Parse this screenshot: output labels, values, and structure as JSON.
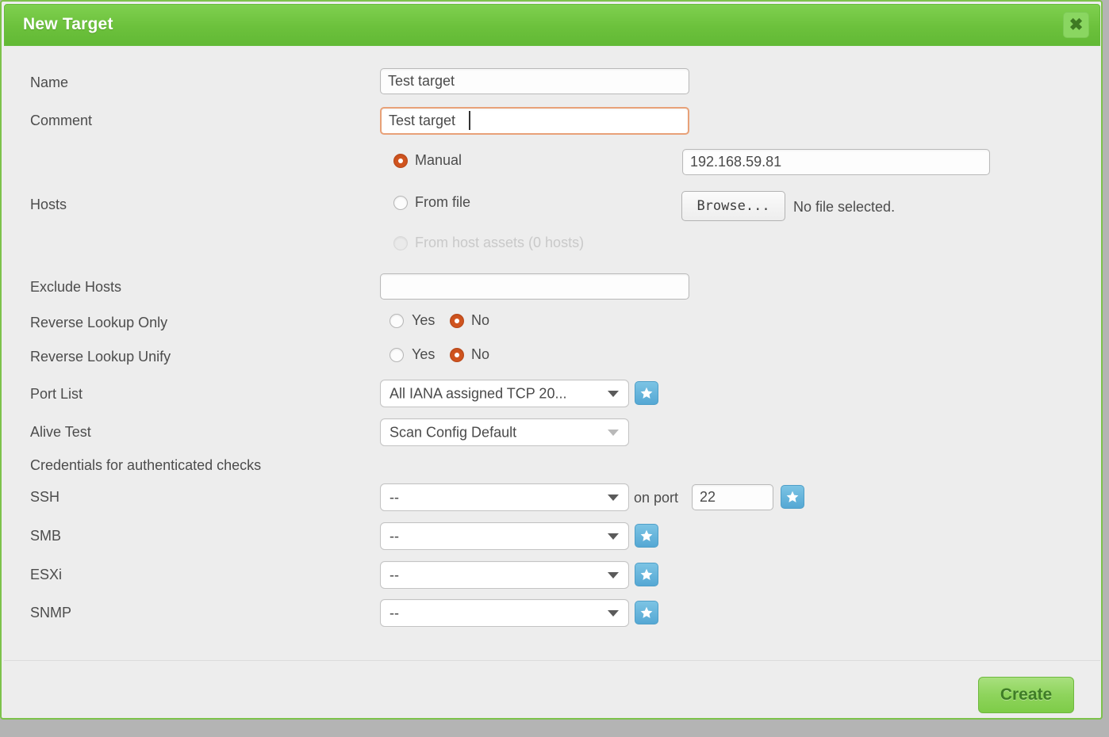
{
  "dialog": {
    "title": "New Target",
    "close_icon": "close-icon",
    "accent_green": "#6cc13c",
    "background": "#ededed",
    "focus_orange": "#e8a178",
    "radio_selected": "#d0541f",
    "star_blue": "#55a8d4"
  },
  "fields": {
    "name": {
      "label": "Name",
      "value": "Test target",
      "placeholder": ""
    },
    "comment": {
      "label": "Comment",
      "value": "Test target ",
      "placeholder": "",
      "focused": true
    },
    "hosts": {
      "label": "Hosts",
      "options": [
        {
          "label": "Manual",
          "selected": true,
          "disabled": false
        },
        {
          "label": "From file",
          "selected": false,
          "disabled": false
        },
        {
          "label": "From host assets (0 hosts)",
          "selected": false,
          "disabled": true
        }
      ],
      "manual_value": "192.168.59.81",
      "browse_label": "Browse...",
      "file_status": "No file selected."
    },
    "exclude_hosts": {
      "label": "Exclude Hosts",
      "value": "",
      "placeholder": ""
    },
    "reverse_lookup_only": {
      "label": "Reverse Lookup Only",
      "yes_label": "Yes",
      "no_label": "No",
      "selected": "No"
    },
    "reverse_lookup_unify": {
      "label": "Reverse Lookup Unify",
      "yes_label": "Yes",
      "no_label": "No",
      "selected": "No"
    },
    "port_list": {
      "label": "Port List",
      "value": "All IANA assigned TCP 20...",
      "star_icon": "star-icon"
    },
    "alive_test": {
      "label": "Alive Test",
      "value": "Scan Config Default"
    },
    "credentials_heading": "Credentials for authenticated checks",
    "ssh": {
      "label": "SSH",
      "value": "--",
      "on_port_label": "on port",
      "port_value": "22",
      "star_icon": "star-icon"
    },
    "smb": {
      "label": "SMB",
      "value": "--",
      "star_icon": "star-icon"
    },
    "esxi": {
      "label": "ESXi",
      "value": "--",
      "star_icon": "star-icon"
    },
    "snmp": {
      "label": "SNMP",
      "value": "--",
      "star_icon": "star-icon"
    }
  },
  "footer": {
    "create_label": "Create"
  }
}
